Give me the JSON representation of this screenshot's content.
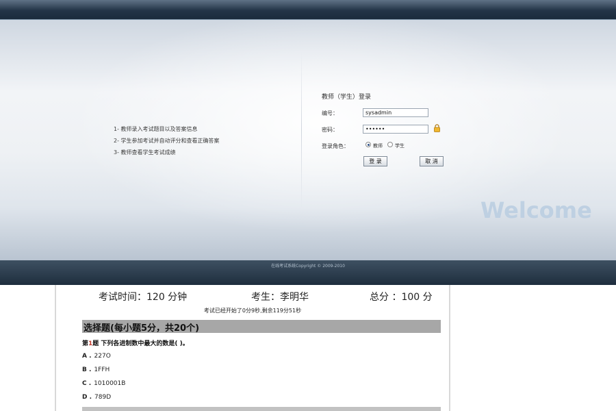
{
  "login": {
    "features": [
      "1- 教师录入考试题目以及答案信息",
      "2- 学生参加考试并自动评分和查看正确答案",
      "3- 教师查看学生考试成绩"
    ],
    "title": "教师（学生）登录",
    "id_label": "编号：",
    "id_value": "sysadmin",
    "password_label": "密码：",
    "password_value": "••••••",
    "role_label": "登录角色：",
    "roles": [
      "教师",
      "学生"
    ],
    "selected_role": "教师",
    "login_button": "登 录",
    "cancel_button": "取 消",
    "welcome": "Welcome",
    "copyright": "在线考试系统Copyright © 2009-2010"
  },
  "exam": {
    "duration": "考试时间：120 分钟",
    "examinee": "考生：李明华",
    "total": "总分 ：100 分",
    "elapsed": "考试已经开始了0分9秒,剩余119分51秒",
    "section_title": "选择题(每小题5分，共20个)",
    "question": {
      "prefix": "第",
      "number": "1",
      "suffix": "题 下列各进制数中最大的数是( )。"
    },
    "options": [
      {
        "letter": "A .",
        "text": "227O"
      },
      {
        "letter": "B .",
        "text": "1FFH"
      },
      {
        "letter": "C .",
        "text": "1010001B"
      },
      {
        "letter": "D .",
        "text": "789D"
      }
    ]
  },
  "colors": {
    "header_dark": "#1b2b3c",
    "section_bar": "#a7a7a7",
    "question_number": "#c0392b"
  }
}
